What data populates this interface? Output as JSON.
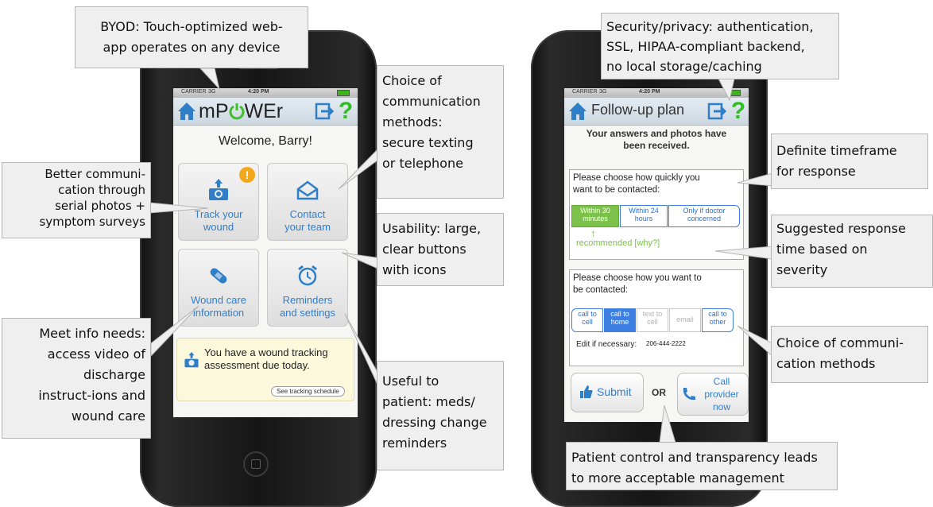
{
  "left_phone": {
    "status": {
      "carrier": "CARRIER",
      "network": "3G",
      "time": "4:20 PM"
    },
    "app_title_left": "mP",
    "app_title_right": "WEr",
    "help_label": "?",
    "welcome": "Welcome, Barry!",
    "tiles": {
      "track_line1": "Track your",
      "track_line2": "wound",
      "track_badge": "!",
      "contact_line1": "Contact",
      "contact_line2": "your team",
      "woundcare_line1": "Wound care",
      "woundcare_line2": "information",
      "reminders_line1": "Reminders",
      "reminders_line2": "and settings"
    },
    "notice_line1": "You have a wound tracking",
    "notice_line2": "assessment due today.",
    "schedule_link": "See tracking schedule"
  },
  "right_phone": {
    "status": {
      "carrier": "CARRIER",
      "network": "3G",
      "time": "4:20 PM"
    },
    "title": "Follow-up plan",
    "help_label": "?",
    "received_line1": "Your answers and photos have",
    "received_line2": "been received.",
    "timeframe_prompt_line1": "Please choose how quickly you",
    "timeframe_prompt_line2": "want to be contacted:",
    "timeframe_options": [
      {
        "line1": "Within 30",
        "line2": "minutes"
      },
      {
        "line1": "Within 24",
        "line2": "hours"
      },
      {
        "line1": "Only if doctor",
        "line2": "concerned"
      }
    ],
    "recommended_arrow": "↑",
    "recommended_text": "recommended [why?]",
    "method_prompt_line1": "Please choose how you want to",
    "method_prompt_line2": "be contacted:",
    "method_options": [
      {
        "line1": "call to",
        "line2": "cell"
      },
      {
        "line1": "call to",
        "line2": "home"
      },
      {
        "line1": "text to",
        "line2": "cell"
      },
      {
        "line1": "email",
        "line2": ""
      },
      {
        "line1": "call to",
        "line2": "other"
      }
    ],
    "edit_label": "Edit if necessary:",
    "edit_phone": "206-444-2222",
    "submit_label": "Submit",
    "or_label": "OR",
    "call_line1": "Call",
    "call_line2": "provider",
    "call_line3": "now"
  },
  "callouts": {
    "byod_line1": "BYOD: Touch-optimized web-",
    "byod_line2": "app operates on any device",
    "better_comm_lines": [
      "Better communi-",
      "cation through",
      "serial photos +",
      "symptom surveys"
    ],
    "choice_comm_lines": [
      "Choice of",
      "communication",
      "methods:",
      "secure texting",
      "or telephone"
    ],
    "usability_lines": [
      "Usability: large,",
      "clear buttons",
      "with icons"
    ],
    "meet_info_lines": [
      "Meet info needs:",
      "access video of",
      "discharge",
      "instruct-ions and",
      "wound care"
    ],
    "useful_lines": [
      "Useful to",
      "patient: meds/",
      "dressing change",
      "reminders"
    ],
    "security_lines": [
      "Security/privacy: authentication,",
      "SSL, HIPAA-compliant backend,",
      "no local storage/caching"
    ],
    "timeframe_lines": [
      "Definite timeframe",
      "for response"
    ],
    "suggested_lines": [
      "Suggested response",
      "time based on",
      "severity"
    ],
    "choice_methods_lines": [
      "Choice of communi-",
      "cation methods"
    ],
    "patient_control_lines": [
      "Patient control and transparency leads",
      "to more acceptable management"
    ]
  },
  "colors": {
    "accent_blue": "#2e7fd0",
    "power_green": "#3fbf2a",
    "recommended_green": "#7cc14a",
    "badge_orange": "#f2a81c",
    "callout_bg": "#efefef"
  },
  "icons": [
    "home-icon",
    "power-icon",
    "exit-icon",
    "camera-icon",
    "envelope-icon",
    "bandage-icon",
    "alarm-clock-icon",
    "thumbs-up-icon",
    "phone-icon"
  ]
}
